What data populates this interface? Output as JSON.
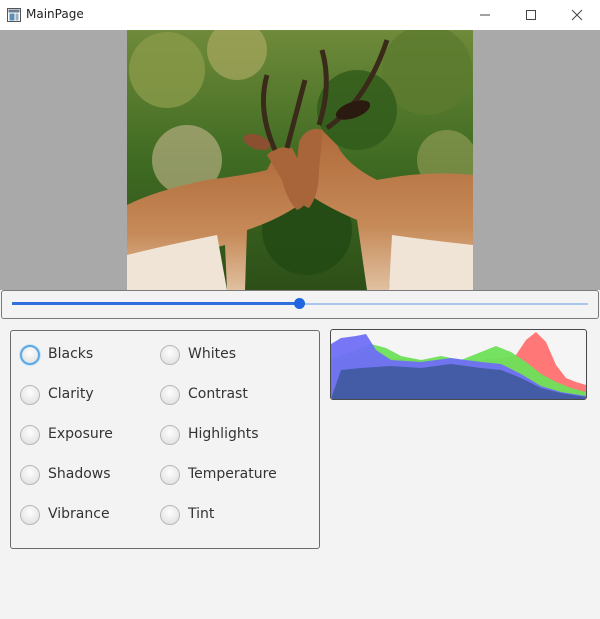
{
  "window": {
    "title": "MainPage",
    "app_icon": "app-window-icon",
    "controls": [
      "minimize-icon",
      "maximize-icon",
      "close-icon"
    ]
  },
  "image_view": {
    "description_icon": "photo",
    "background": "#a9a9a9"
  },
  "slider": {
    "value_fraction": 0.5,
    "accent": "#1f66e0"
  },
  "options": {
    "selected": "Blacks",
    "items": [
      {
        "label": "Blacks",
        "selected": true
      },
      {
        "label": "Whites",
        "selected": false
      },
      {
        "label": "Clarity",
        "selected": false
      },
      {
        "label": "Contrast",
        "selected": false
      },
      {
        "label": "Exposure",
        "selected": false
      },
      {
        "label": "Highlights",
        "selected": false
      },
      {
        "label": "Shadows",
        "selected": false
      },
      {
        "label": "Temperature",
        "selected": false
      },
      {
        "label": "Vibrance",
        "selected": false
      },
      {
        "label": "Tint",
        "selected": false
      }
    ]
  },
  "histogram": {
    "colors": {
      "red": "#ff7070",
      "green": "#6ee05a",
      "blue": "#6f6ff7",
      "overlap": "#3e5a9c"
    }
  }
}
